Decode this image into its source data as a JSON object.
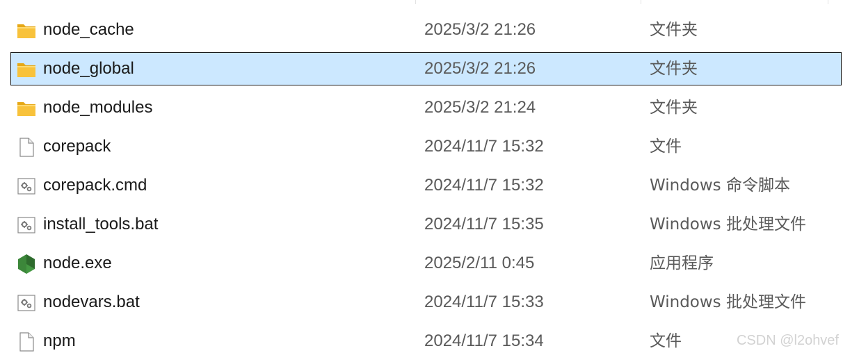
{
  "files": [
    {
      "name": "node_cache",
      "date": "2025/3/2 21:26",
      "type": "文件夹",
      "icon": "folder-icon",
      "selected": false
    },
    {
      "name": "node_global",
      "date": "2025/3/2 21:26",
      "type": "文件夹",
      "icon": "folder-icon",
      "selected": true
    },
    {
      "name": "node_modules",
      "date": "2025/3/2 21:24",
      "type": "文件夹",
      "icon": "folder-icon",
      "selected": false
    },
    {
      "name": "corepack",
      "date": "2024/11/7 15:32",
      "type": "文件",
      "icon": "file-icon",
      "selected": false
    },
    {
      "name": "corepack.cmd",
      "date": "2024/11/7 15:32",
      "type": "Windows 命令脚本",
      "icon": "script-icon",
      "selected": false
    },
    {
      "name": "install_tools.bat",
      "date": "2024/11/7 15:35",
      "type": "Windows 批处理文件",
      "icon": "script-icon",
      "selected": false
    },
    {
      "name": "node.exe",
      "date": "2025/2/11 0:45",
      "type": "应用程序",
      "icon": "nodejs-icon",
      "selected": false
    },
    {
      "name": "nodevars.bat",
      "date": "2024/11/7 15:33",
      "type": "Windows 批处理文件",
      "icon": "script-icon",
      "selected": false
    },
    {
      "name": "npm",
      "date": "2024/11/7 15:34",
      "type": "文件",
      "icon": "file-icon",
      "selected": false
    }
  ],
  "watermark": "CSDN @l2ohvef",
  "colors": {
    "selection_bg": "#cce8ff",
    "folder": "#f8c23b",
    "node_green": "#3c873a"
  }
}
